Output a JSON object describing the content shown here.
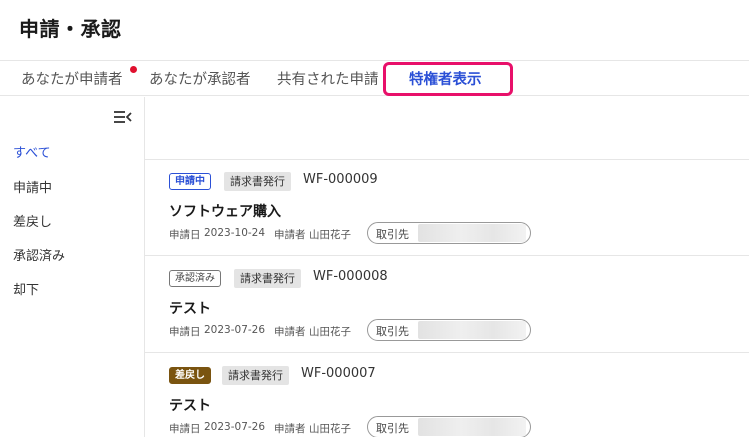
{
  "header": {
    "title": "申請・承認"
  },
  "tabs": [
    {
      "label": "あなたが申請者",
      "has_dot": true
    },
    {
      "label": "あなたが承認者"
    },
    {
      "label": "共有された申請"
    },
    {
      "label": "特権者表示",
      "active": true
    }
  ],
  "sidebar": {
    "collapse_icon": "sidebar-collapse-icon",
    "items": [
      {
        "label": "すべて",
        "active": true
      },
      {
        "label": "申請中"
      },
      {
        "label": "差戻し"
      },
      {
        "label": "承認済み"
      },
      {
        "label": "却下"
      }
    ]
  },
  "requests": [
    {
      "status": "申請中",
      "category": "請求書発行",
      "id": "WF-000009",
      "title": "ソフトウェア購入",
      "date_label": "申請日",
      "date": "2023-10-24",
      "applicant_label": "申請者",
      "applicant": "山田花子",
      "partner_label": "取引先"
    },
    {
      "status": "承認済み",
      "category": "請求書発行",
      "id": "WF-000008",
      "title": "テスト",
      "date_label": "申請日",
      "date": "2023-07-26",
      "applicant_label": "申請者",
      "applicant": "山田花子",
      "partner_label": "取引先"
    },
    {
      "status": "差戻し",
      "category": "請求書発行",
      "id": "WF-000007",
      "title": "テスト",
      "date_label": "申請日",
      "date": "2023-07-26",
      "applicant_label": "申請者",
      "applicant": "山田花子",
      "partner_label": "取引先"
    }
  ],
  "colors": {
    "accent": "#2b50d6",
    "highlight": "#e8106a",
    "notification_dot": "#e0102e",
    "returned_badge": "#7a5410"
  }
}
